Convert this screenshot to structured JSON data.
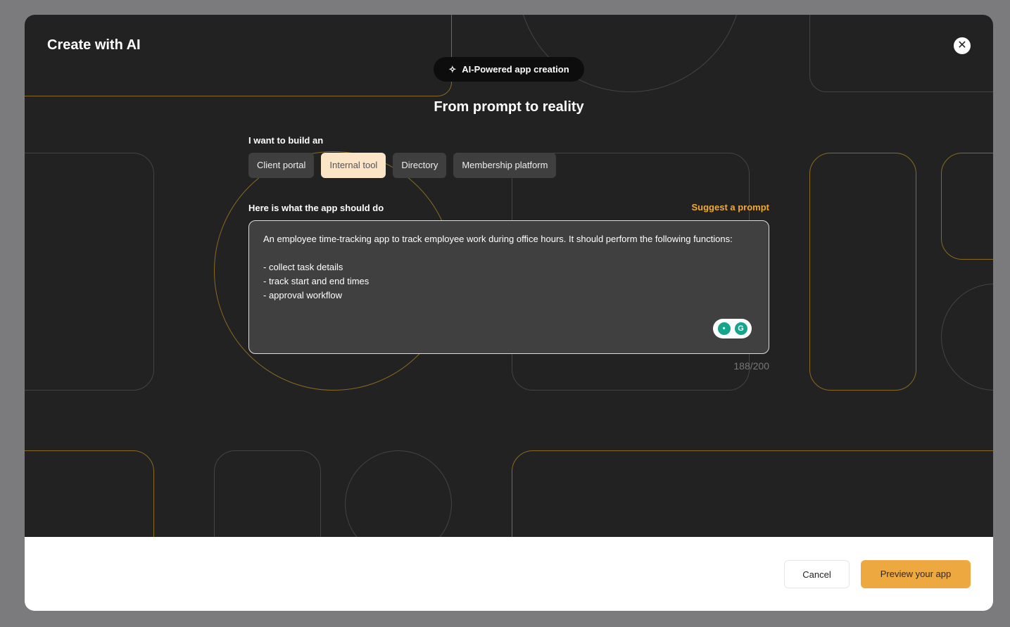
{
  "dialog": {
    "title": "Create with AI",
    "close_icon": "close-icon"
  },
  "badge": {
    "icon": "sparkles-icon",
    "label": "AI-Powered app creation"
  },
  "heading": "From prompt to reality",
  "build": {
    "label": "I want to build an",
    "options": [
      "Client portal",
      "Internal tool",
      "Directory",
      "Membership platform"
    ],
    "selected": "Internal tool"
  },
  "prompt": {
    "label": "Here is what the app should do",
    "suggest": "Suggest a prompt",
    "value": "An employee time-tracking app to track employee work during office hours. It should perform the following functions:\n\n- collect task details\n- track start and end times\n- approval workflow",
    "count": "188/200"
  },
  "footer": {
    "cancel": "Cancel",
    "preview": "Preview your app"
  },
  "colors": {
    "accent": "#eda93f",
    "selected_chip": "#fbe5c6"
  }
}
